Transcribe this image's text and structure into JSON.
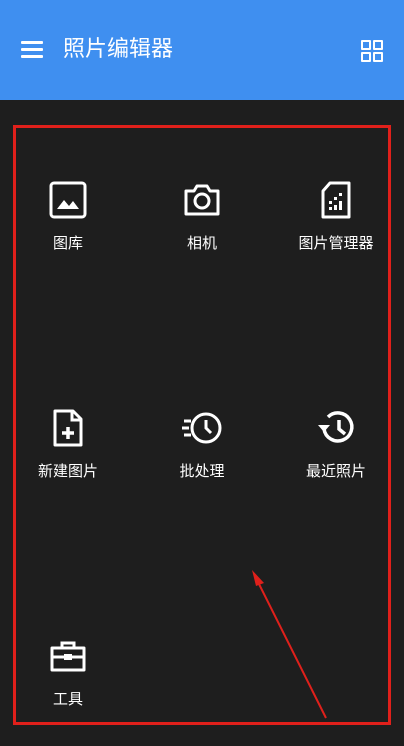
{
  "app_bar": {
    "title": "照片编辑器",
    "background_color": "#3f8ff0",
    "menu_icon": "hamburger-menu-icon",
    "view_icon": "grid-view-icon"
  },
  "tiles": [
    {
      "label": "图库",
      "icon": "gallery-image-icon"
    },
    {
      "label": "相机",
      "icon": "camera-icon"
    },
    {
      "label": "图片管理器",
      "icon": "sd-card-icon"
    },
    {
      "label": "新建图片",
      "icon": "new-file-plus-icon"
    },
    {
      "label": "批处理",
      "icon": "batch-clock-icon"
    },
    {
      "label": "最近照片",
      "icon": "history-icon"
    },
    {
      "label": "工具",
      "icon": "toolbox-icon"
    }
  ],
  "annotation": {
    "highlight_color": "#e0201b"
  }
}
